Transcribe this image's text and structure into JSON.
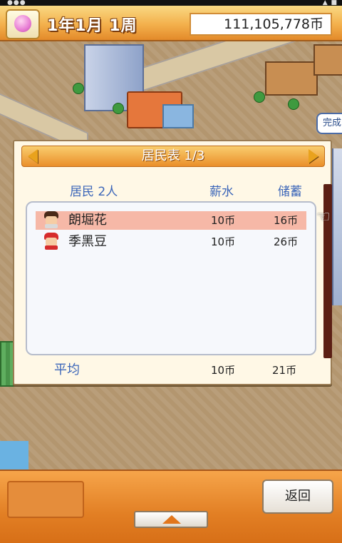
{
  "header": {
    "date": "1年1月 1周",
    "money": "111,105,778币"
  },
  "map": {
    "done_badge": "完成"
  },
  "dialog": {
    "title": "居民表 1/3",
    "columns": {
      "residents": "居民 2人",
      "salary": "薪水",
      "savings": "储蓄"
    },
    "rows": [
      {
        "name": "朗堀花",
        "salary": "10币",
        "savings": "16币",
        "selected": true
      },
      {
        "name": "季黑豆",
        "salary": "10币",
        "savings": "26币",
        "selected": false
      }
    ],
    "average": {
      "label": "平均",
      "salary": "10币",
      "savings": "21币"
    }
  },
  "footer": {
    "back_label": "返回"
  },
  "colors": {
    "accent": "#e38a2a",
    "header_text": "#3c66b9",
    "selected_row": "#f6b8a7"
  },
  "icons": [
    "blossom-icon",
    "left-arrow-icon",
    "right-arrow-icon",
    "pointing-hand-icon",
    "up-arrow-icon"
  ]
}
